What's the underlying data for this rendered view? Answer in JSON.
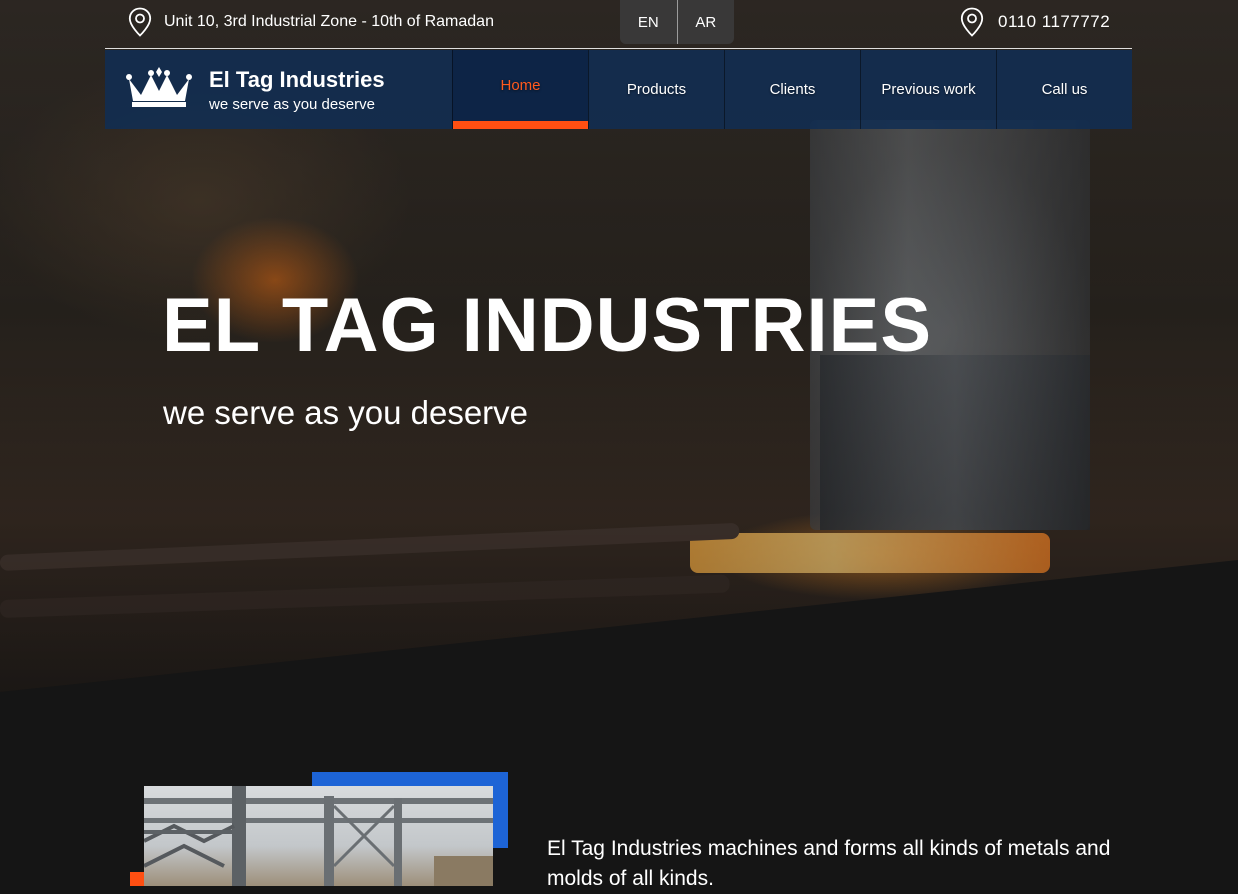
{
  "topbar": {
    "address": "Unit 10, 3rd Industrial Zone - 10th of Ramadan",
    "address_icon": "map-pin-icon",
    "languages": [
      "EN",
      "AR"
    ],
    "phone": "0110 1177772",
    "phone_icon": "map-pin-icon"
  },
  "brand": {
    "name": "El Tag Industries",
    "tagline": "we serve as you deserve",
    "logo_icon": "crown-icon"
  },
  "nav": {
    "items": [
      {
        "label": "Home"
      },
      {
        "label": "Products"
      },
      {
        "label": "Clients"
      },
      {
        "label": "Previous work"
      },
      {
        "label": "Call us"
      }
    ],
    "active": "Home"
  },
  "hero": {
    "title": "EL TAG INDUSTRIES",
    "subtitle": "we serve as you deserve"
  },
  "about": {
    "text": "El Tag Industries machines and forms all kinds of metals and molds of all kinds."
  },
  "colors": {
    "accent": "#ff4f12",
    "nav_bg": "#112d52",
    "blue_block": "#1d64d6",
    "section_bg": "#151515"
  }
}
